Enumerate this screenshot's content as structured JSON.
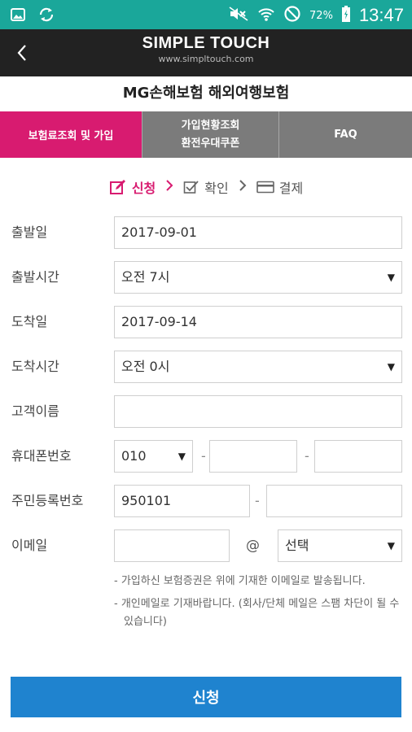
{
  "status_bar": {
    "left_icons": [
      "gallery-icon",
      "sync-icon"
    ],
    "right_icons": [
      "mute-icon",
      "wifi-icon",
      "do-not-disturb-icon"
    ],
    "battery_percent": "72%",
    "time": "13:47"
  },
  "app_bar": {
    "brand": "SIMPLE TOUCH",
    "url": "www.simpltouch.com"
  },
  "page": {
    "title": "MG손해보험 해외여행보험"
  },
  "tabs": [
    {
      "label": "보험료조회 및 가입",
      "active": true
    },
    {
      "line1": "가입현황조회",
      "line2": "환전우대쿠폰",
      "active": false
    },
    {
      "label": "FAQ",
      "active": false
    }
  ],
  "steps": [
    {
      "label": "신청",
      "icon": "edit-icon",
      "active": true
    },
    {
      "label": "확인",
      "icon": "checkbox-icon",
      "active": false
    },
    {
      "label": "결제",
      "icon": "card-icon",
      "active": false
    }
  ],
  "form": {
    "departure_date": {
      "label": "출발일",
      "value": "2017-09-01"
    },
    "departure_time": {
      "label": "출발시간",
      "value": "오전 7시"
    },
    "arrival_date": {
      "label": "도착일",
      "value": "2017-09-14"
    },
    "arrival_time": {
      "label": "도착시간",
      "value": "오전 0시"
    },
    "customer_name": {
      "label": "고객이름",
      "value": ""
    },
    "phone": {
      "label": "휴대폰번호",
      "prefix": "010",
      "middle": "",
      "last": "",
      "separator": "-"
    },
    "resident_number": {
      "label": "주민등록번호",
      "front": "950101",
      "back": "",
      "separator": "-"
    },
    "email": {
      "label": "이메일",
      "local": "",
      "at": "@",
      "domain": "선택"
    }
  },
  "notes": [
    "- 가입하신 보험증권은 위에 기재한 이메일로 발송됩니다.",
    "- 개인메일로 기재바랍니다. (회사/단체 메일은 스팸 차단이 될 수 있습니다)"
  ],
  "submit_label": "신청",
  "colors": {
    "status_bar": "#1aa79a",
    "app_bar": "#222222",
    "accent_pink": "#d81b70",
    "tab_inactive": "#7b7b7b",
    "button_blue": "#1f83cf"
  }
}
